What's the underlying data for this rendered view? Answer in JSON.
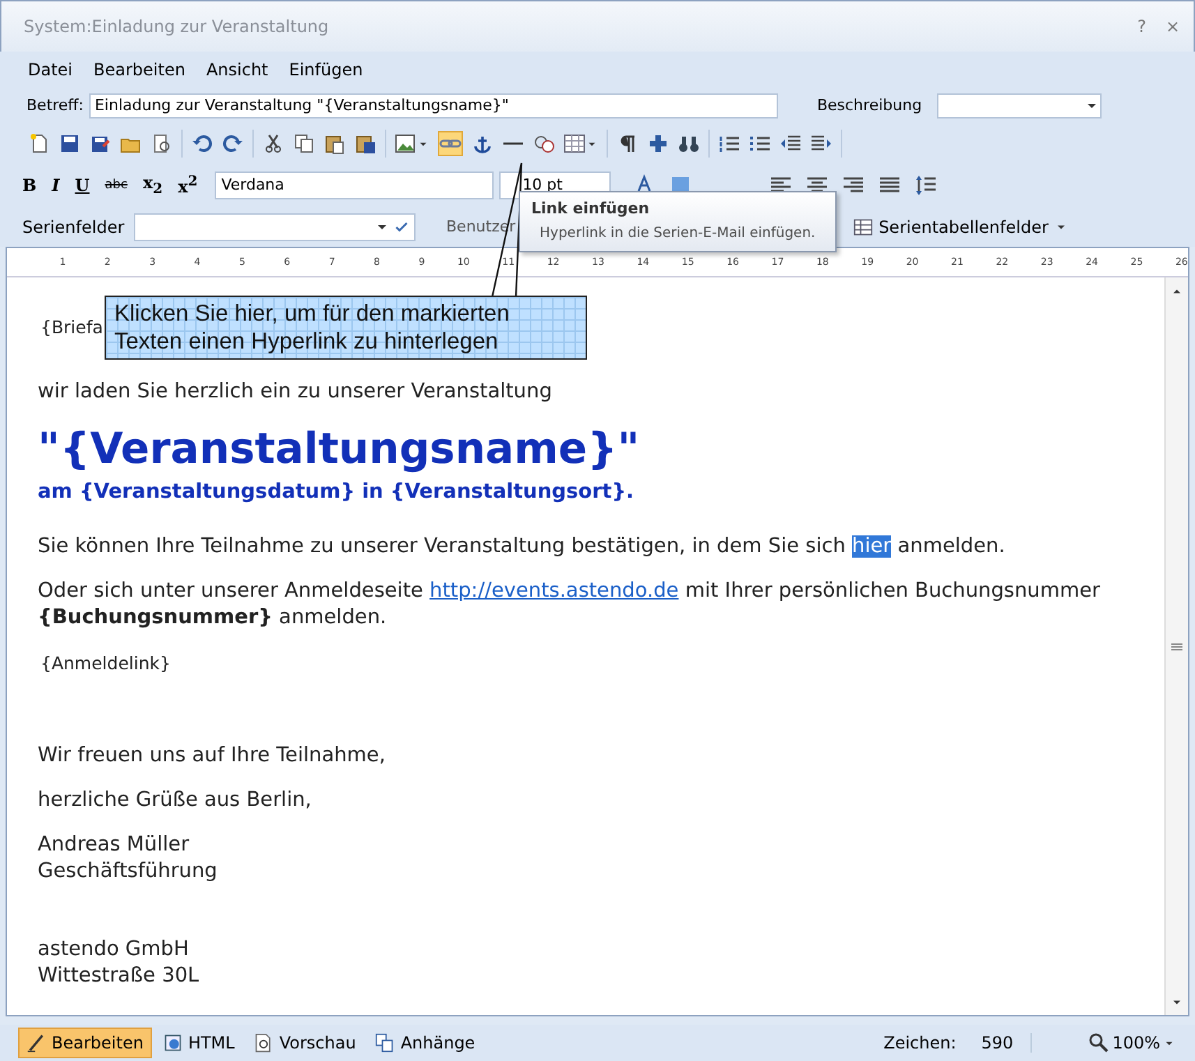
{
  "window": {
    "title": "System:Einladung zur Veranstaltung",
    "controls": [
      "?",
      "×"
    ]
  },
  "menu": [
    "Datei",
    "Bearbeiten",
    "Ansicht",
    "Einfügen"
  ],
  "subject": {
    "label": "Betreff:",
    "value": "Einladung zur Veranstaltung \"{Veranstaltungsname}\"",
    "description_label": "Beschreibung"
  },
  "format_bar": {
    "styles": [
      "B",
      "I",
      "U",
      "abc",
      "x$_{2}$",
      "x$^{2}$"
    ],
    "font": "Verdana",
    "size": "10 pt"
  },
  "merge_bar": {
    "label": "Serienfelder",
    "user_fields": "Benutzer",
    "table_fields": "Serientabellenfelder"
  },
  "ruler": [
    "1",
    "2",
    "3",
    "4",
    "5",
    "6",
    "7",
    "8",
    "9",
    "10",
    "11",
    "12",
    "13",
    "14",
    "15",
    "16",
    "17",
    "18",
    "19",
    "20",
    "21",
    "22",
    "23",
    "24",
    "25",
    "26"
  ],
  "document": [
    {
      "kind": "field",
      "segments": [
        {
          "text": "{Briefa",
          "kind": "plain"
        }
      ]
    },
    {
      "kind": "text",
      "segments": [
        {
          "text": "wir laden Sie herzlich ein zu unserer Veranstaltung",
          "kind": "plain"
        }
      ]
    },
    {
      "kind": "heading",
      "segments": [
        {
          "text": "\"{Veranstaltungsname}\"",
          "kind": "plain"
        }
      ]
    },
    {
      "kind": "subheading",
      "segments": [
        {
          "text": "am {Veranstaltungsdatum} in {Veranstaltungsort}.",
          "kind": "plain"
        }
      ]
    },
    {
      "kind": "text",
      "segments": [
        {
          "text": "Sie können Ihre Teilnahme zu unserer Veranstaltung bestätigen, in dem Sie sich ",
          "kind": "plain"
        },
        {
          "text": "hier",
          "kind": "selected"
        },
        {
          "text": " anmelden.",
          "kind": "plain"
        }
      ]
    },
    {
      "kind": "text",
      "segments": [
        {
          "text": "Oder sich unter unserer Anmeldeseite ",
          "kind": "plain"
        },
        {
          "text": "http://events.astendo.de",
          "kind": "link"
        },
        {
          "text": " mit Ihrer persönlichen Buchungsnummer ",
          "kind": "plain"
        },
        {
          "text": "{Buchungsnummer}",
          "kind": "bold"
        },
        {
          "text": " anmelden.",
          "kind": "plain"
        }
      ]
    },
    {
      "kind": "field",
      "segments": [
        {
          "text": "{Anmeldelink}",
          "kind": "plain"
        }
      ]
    },
    {
      "kind": "gap"
    },
    {
      "kind": "text",
      "segments": [
        {
          "text": "Wir freuen uns auf Ihre Teilnahme,",
          "kind": "plain"
        }
      ]
    },
    {
      "kind": "text",
      "segments": [
        {
          "text": "herzliche Grüße aus Berlin,",
          "kind": "plain"
        }
      ]
    },
    {
      "kind": "lines",
      "segments": [
        {
          "text": "Andreas Müller",
          "kind": "plain"
        },
        {
          "text": "Geschäftsführung",
          "kind": "plain"
        }
      ]
    },
    {
      "kind": "gap"
    },
    {
      "kind": "lines",
      "segments": [
        {
          "text": "astendo GmbH",
          "kind": "plain"
        },
        {
          "text": "Wittestraße 30L",
          "kind": "plain"
        }
      ]
    }
  ],
  "callout": {
    "text": "Klicken Sie hier, um für den markierten Texten einen Hyperlink zu hinterlegen"
  },
  "tooltip": {
    "title": "Link einfügen",
    "text": "Hyperlink in die Serien-E-Mail einfügen."
  },
  "status_bar": {
    "tabs": [
      {
        "label": "Bearbeiten",
        "selected": true
      },
      {
        "label": "HTML",
        "selected": false
      },
      {
        "label": "Vorschau",
        "selected": false
      },
      {
        "label": "Anhänge",
        "selected": false
      }
    ],
    "count_label": "Zeichen:",
    "count": "590",
    "zoom": "100%"
  }
}
